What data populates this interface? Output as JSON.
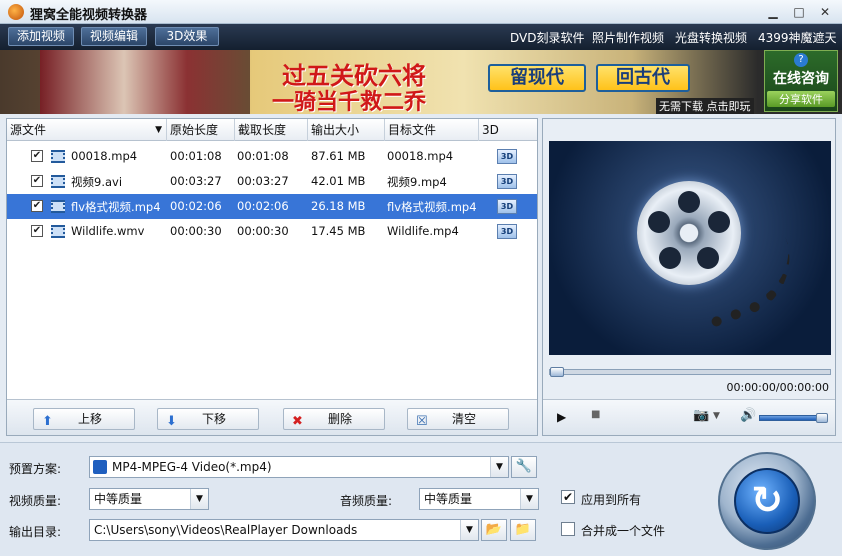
{
  "window": {
    "title": "狸窝全能视频转换器",
    "min": "▁",
    "max": "□",
    "close": "✕"
  },
  "toolbar": {
    "buttons": [
      "添加视频",
      "视频编辑",
      "3D效果"
    ],
    "links": [
      "DVD刻录软件",
      "照片制作视频",
      "光盘转换视频",
      "4399神魔遮天"
    ]
  },
  "banner": {
    "line1": "过五关砍六将",
    "line2": "一骑当千救二乔",
    "btn1": "留现代",
    "btn2": "回古代",
    "small": "无需下载 点击即玩",
    "consult_title": "在线咨询",
    "share": "分享软件",
    "help": "?"
  },
  "list": {
    "headers": [
      "源文件",
      "原始长度",
      "截取长度",
      "输出大小",
      "目标文件",
      "3D"
    ],
    "rows": [
      {
        "checked": "✔",
        "source": "00018.mp4",
        "orig": "00:01:08",
        "cut": "00:01:08",
        "size": "87.61 MB",
        "target": "00018.mp4",
        "d3": "3D"
      },
      {
        "checked": "✔",
        "source": "视频9.avi",
        "orig": "00:03:27",
        "cut": "00:03:27",
        "size": "42.01 MB",
        "target": "视频9.mp4",
        "d3": "3D"
      },
      {
        "checked": "✔",
        "source": "flv格式视频.mp4",
        "orig": "00:02:06",
        "cut": "00:02:06",
        "size": "26.18 MB",
        "target": "flv格式视频.mp4",
        "d3": "3D"
      },
      {
        "checked": "✔",
        "source": "Wildlife.wmv",
        "orig": "00:00:30",
        "cut": "00:00:30",
        "size": "17.45 MB",
        "target": "Wildlife.mp4",
        "d3": "3D"
      }
    ],
    "selected_row": 2,
    "actions": {
      "up": "上移",
      "down": "下移",
      "delete": "删除",
      "clear": "清空"
    }
  },
  "preview": {
    "time": "00:00:00/00:00:00",
    "seek_fraction": 0.0,
    "volume_fraction": 1.0
  },
  "settings": {
    "preset_label": "预置方案:",
    "preset_value": "MP4-MPEG-4 Video(*.mp4)",
    "video_quality_label": "视频质量:",
    "video_quality_value": "中等质量",
    "audio_quality_label": "音频质量:",
    "audio_quality_value": "中等质量",
    "apply_all_label": "应用到所有",
    "apply_all_checked": "✔",
    "output_dir_label": "输出目录:",
    "output_dir_value": "C:\\Users\\sony\\Videos\\RealPlayer Downloads",
    "merge_label": "合并成一个文件"
  }
}
